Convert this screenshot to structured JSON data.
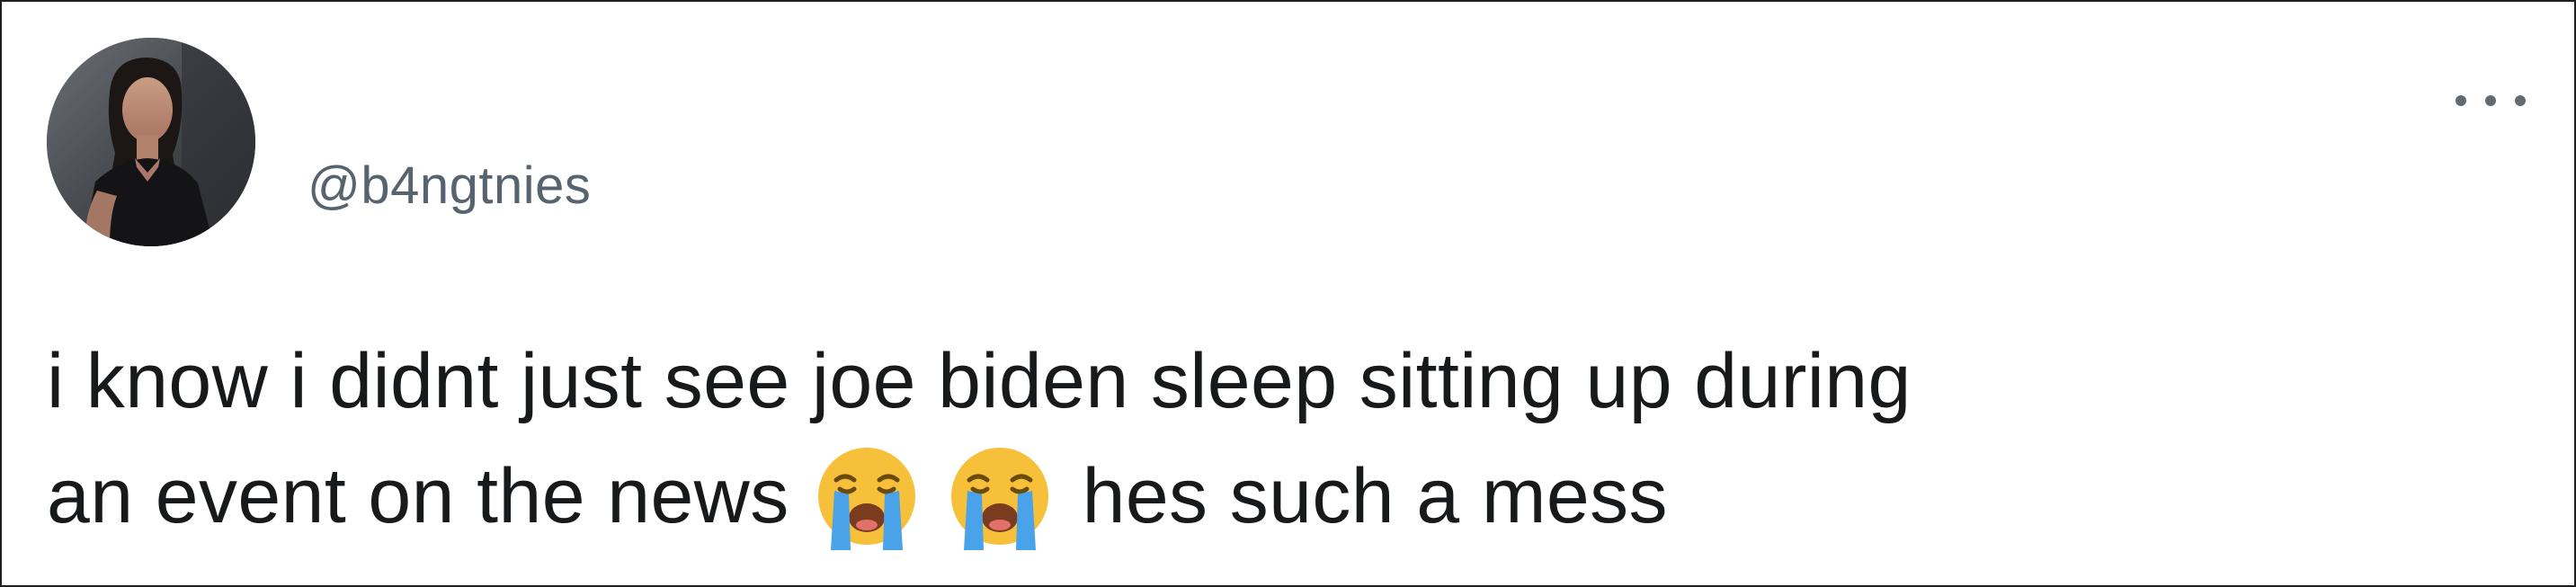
{
  "tweet": {
    "handle": "@b4ngtnies",
    "text_line_1": "i know i didnt just see joe biden sleep sitting up during",
    "text_line_2_before": "an event on the news",
    "text_line_2_after": "hes such a mess",
    "emojis": [
      "loudly-crying-face-icon",
      "loudly-crying-face-icon"
    ]
  },
  "menu": {
    "icon": "more-horizontal-icon"
  },
  "colors": {
    "text": "#17191b",
    "handle": "#57636e",
    "border": "#1f1f1f",
    "emoji_face": "#f6c03a",
    "emoji_tears": "#4aa3e8"
  }
}
